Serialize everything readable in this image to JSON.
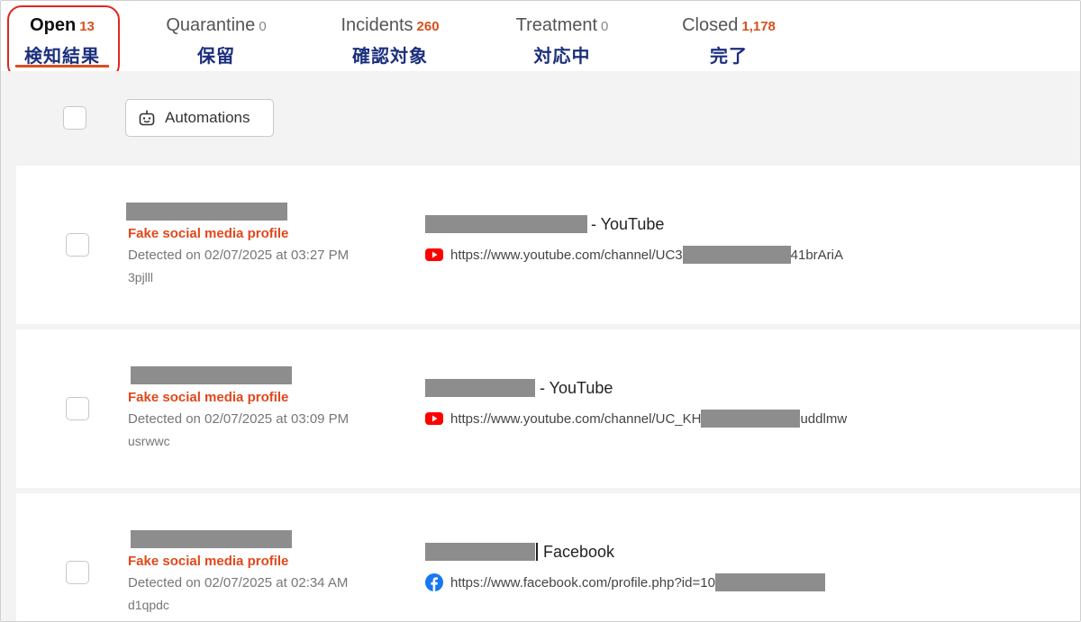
{
  "tabs": [
    {
      "title": "Open",
      "count": "13",
      "jp": "検知結果"
    },
    {
      "title": "Quarantine",
      "count": "0",
      "jp": "保留"
    },
    {
      "title": "Incidents",
      "count": "260",
      "jp": "確認対象"
    },
    {
      "title": "Treatment",
      "count": "0",
      "jp": "対応中"
    },
    {
      "title": "Closed",
      "count": "1,178",
      "jp": "完了"
    }
  ],
  "toolbar": {
    "automations_label": "Automations"
  },
  "items": [
    {
      "tag": "Fake social media profile",
      "detected": "Detected on 02/07/2025 at 03:27 PM",
      "code": "3pjlll",
      "title_suffix": "- YouTube",
      "url_start": "https://www.youtube.com/channel/UC3",
      "url_end": "41brAriA",
      "platform_icon": "youtube-icon"
    },
    {
      "tag": "Fake social media profile",
      "detected": "Detected on 02/07/2025 at 03:09 PM",
      "code": "usrwwc",
      "title_suffix": "- YouTube",
      "url_start": "https://www.youtube.com/channel/UC_KH",
      "url_end": "uddlmw",
      "platform_icon": "youtube-icon"
    },
    {
      "tag": "Fake social media profile",
      "detected": "Detected on 02/07/2025 at 02:34 AM",
      "code": "d1qpdc",
      "title_suffix": "Facebook",
      "url_start": "https://www.facebook.com/profile.php?id=10",
      "url_end": "",
      "platform_icon": "facebook-icon"
    }
  ],
  "colors": {
    "accent": "#d8501f",
    "highlight": "#e0281e",
    "jp_label": "#1b2f7d",
    "redaction": "#8d8d8d"
  }
}
